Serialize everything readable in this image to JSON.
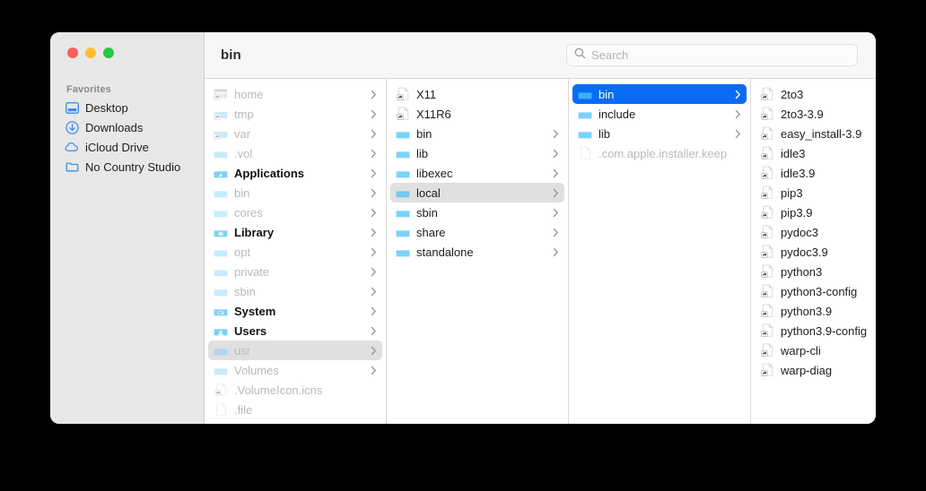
{
  "window": {
    "title": "bin",
    "traffic_lights": [
      {
        "name": "close-button",
        "color": "#ff5f57"
      },
      {
        "name": "minimize-button",
        "color": "#febc2e"
      },
      {
        "name": "maximize-button",
        "color": "#28c840"
      }
    ]
  },
  "search": {
    "placeholder": "Search",
    "value": "",
    "icon": "search-icon"
  },
  "sidebar": {
    "section_title": "Favorites",
    "items": [
      {
        "label": "Desktop",
        "icon": "desktop-icon"
      },
      {
        "label": "Downloads",
        "icon": "downloads-icon"
      },
      {
        "label": "iCloud Drive",
        "icon": "icloud-icon"
      },
      {
        "label": "No Country Studio",
        "icon": "folder-outline-icon"
      }
    ]
  },
  "columns": [
    {
      "name": "column-root",
      "items": [
        {
          "label": "home",
          "icon": "folder-alias-home-icon",
          "kind": "folder",
          "dim": true,
          "bold": false,
          "chevron": true,
          "selected": "none"
        },
        {
          "label": "tmp",
          "icon": "folder-alias-icon",
          "kind": "folder",
          "dim": true,
          "bold": false,
          "chevron": true,
          "selected": "none"
        },
        {
          "label": "var",
          "icon": "folder-alias-icon",
          "kind": "folder",
          "dim": true,
          "bold": false,
          "chevron": true,
          "selected": "none"
        },
        {
          "label": ".vol",
          "icon": "folder-icon",
          "kind": "folder",
          "dim": true,
          "bold": false,
          "chevron": true,
          "selected": "none"
        },
        {
          "label": "Applications",
          "icon": "applications-folder-icon",
          "kind": "folder",
          "dim": false,
          "bold": true,
          "chevron": true,
          "selected": "none"
        },
        {
          "label": "bin",
          "icon": "folder-icon",
          "kind": "folder",
          "dim": true,
          "bold": false,
          "chevron": true,
          "selected": "none"
        },
        {
          "label": "cores",
          "icon": "folder-icon",
          "kind": "folder",
          "dim": true,
          "bold": false,
          "chevron": true,
          "selected": "none"
        },
        {
          "label": "Library",
          "icon": "library-folder-icon",
          "kind": "folder",
          "dim": false,
          "bold": true,
          "chevron": true,
          "selected": "none"
        },
        {
          "label": "opt",
          "icon": "folder-icon",
          "kind": "folder",
          "dim": true,
          "bold": false,
          "chevron": true,
          "selected": "none"
        },
        {
          "label": "private",
          "icon": "folder-icon",
          "kind": "folder",
          "dim": true,
          "bold": false,
          "chevron": true,
          "selected": "none"
        },
        {
          "label": "sbin",
          "icon": "folder-icon",
          "kind": "folder",
          "dim": true,
          "bold": false,
          "chevron": true,
          "selected": "none"
        },
        {
          "label": "System",
          "icon": "system-folder-icon",
          "kind": "folder",
          "dim": false,
          "bold": true,
          "chevron": true,
          "selected": "none"
        },
        {
          "label": "Users",
          "icon": "users-folder-icon",
          "kind": "folder",
          "dim": false,
          "bold": true,
          "chevron": true,
          "selected": "none"
        },
        {
          "label": "usr",
          "icon": "folder-icon",
          "kind": "folder",
          "dim": true,
          "bold": false,
          "chevron": true,
          "selected": "inactive"
        },
        {
          "label": "Volumes",
          "icon": "folder-icon",
          "kind": "folder",
          "dim": true,
          "bold": false,
          "chevron": true,
          "selected": "none"
        },
        {
          "label": ".VolumeIcon.icns",
          "icon": "file-alias-icon",
          "kind": "file",
          "dim": true,
          "bold": false,
          "chevron": false,
          "selected": "none"
        },
        {
          "label": ".file",
          "icon": "file-icon",
          "kind": "file",
          "dim": true,
          "bold": false,
          "chevron": false,
          "selected": "none"
        }
      ]
    },
    {
      "name": "column-usr",
      "items": [
        {
          "label": "X11",
          "icon": "file-alias-icon",
          "kind": "file",
          "dim": false,
          "bold": false,
          "chevron": false,
          "selected": "none"
        },
        {
          "label": "X11R6",
          "icon": "file-alias-icon",
          "kind": "file",
          "dim": false,
          "bold": false,
          "chevron": false,
          "selected": "none"
        },
        {
          "label": "bin",
          "icon": "folder-icon",
          "kind": "folder",
          "dim": false,
          "bold": false,
          "chevron": true,
          "selected": "none"
        },
        {
          "label": "lib",
          "icon": "folder-icon",
          "kind": "folder",
          "dim": false,
          "bold": false,
          "chevron": true,
          "selected": "none"
        },
        {
          "label": "libexec",
          "icon": "folder-icon",
          "kind": "folder",
          "dim": false,
          "bold": false,
          "chevron": true,
          "selected": "none"
        },
        {
          "label": "local",
          "icon": "folder-icon",
          "kind": "folder",
          "dim": false,
          "bold": false,
          "chevron": true,
          "selected": "inactive"
        },
        {
          "label": "sbin",
          "icon": "folder-icon",
          "kind": "folder",
          "dim": false,
          "bold": false,
          "chevron": true,
          "selected": "none"
        },
        {
          "label": "share",
          "icon": "folder-icon",
          "kind": "folder",
          "dim": false,
          "bold": false,
          "chevron": true,
          "selected": "none"
        },
        {
          "label": "standalone",
          "icon": "folder-icon",
          "kind": "folder",
          "dim": false,
          "bold": false,
          "chevron": true,
          "selected": "none"
        }
      ]
    },
    {
      "name": "column-local",
      "items": [
        {
          "label": "bin",
          "icon": "folder-icon",
          "kind": "folder",
          "dim": false,
          "bold": false,
          "chevron": true,
          "selected": "active"
        },
        {
          "label": "include",
          "icon": "folder-icon",
          "kind": "folder",
          "dim": false,
          "bold": false,
          "chevron": true,
          "selected": "none"
        },
        {
          "label": "lib",
          "icon": "folder-icon",
          "kind": "folder",
          "dim": false,
          "bold": false,
          "chevron": true,
          "selected": "none"
        },
        {
          "label": ".com.apple.installer.keep",
          "icon": "file-icon",
          "kind": "file",
          "dim": true,
          "bold": false,
          "chevron": false,
          "selected": "none"
        }
      ]
    },
    {
      "name": "column-bin",
      "items": [
        {
          "label": "2to3",
          "icon": "file-alias-icon",
          "kind": "file",
          "dim": false,
          "bold": false,
          "chevron": false,
          "selected": "none"
        },
        {
          "label": "2to3-3.9",
          "icon": "file-alias-icon",
          "kind": "file",
          "dim": false,
          "bold": false,
          "chevron": false,
          "selected": "none"
        },
        {
          "label": "easy_install-3.9",
          "icon": "file-alias-icon",
          "kind": "file",
          "dim": false,
          "bold": false,
          "chevron": false,
          "selected": "none"
        },
        {
          "label": "idle3",
          "icon": "file-alias-icon",
          "kind": "file",
          "dim": false,
          "bold": false,
          "chevron": false,
          "selected": "none"
        },
        {
          "label": "idle3.9",
          "icon": "file-alias-icon",
          "kind": "file",
          "dim": false,
          "bold": false,
          "chevron": false,
          "selected": "none"
        },
        {
          "label": "pip3",
          "icon": "file-alias-icon",
          "kind": "file",
          "dim": false,
          "bold": false,
          "chevron": false,
          "selected": "none"
        },
        {
          "label": "pip3.9",
          "icon": "file-alias-icon",
          "kind": "file",
          "dim": false,
          "bold": false,
          "chevron": false,
          "selected": "none"
        },
        {
          "label": "pydoc3",
          "icon": "file-alias-icon",
          "kind": "file",
          "dim": false,
          "bold": false,
          "chevron": false,
          "selected": "none"
        },
        {
          "label": "pydoc3.9",
          "icon": "file-alias-icon",
          "kind": "file",
          "dim": false,
          "bold": false,
          "chevron": false,
          "selected": "none"
        },
        {
          "label": "python3",
          "icon": "file-alias-icon",
          "kind": "file",
          "dim": false,
          "bold": false,
          "chevron": false,
          "selected": "none"
        },
        {
          "label": "python3-config",
          "icon": "file-alias-icon",
          "kind": "file",
          "dim": false,
          "bold": false,
          "chevron": false,
          "selected": "none"
        },
        {
          "label": "python3.9",
          "icon": "file-alias-icon",
          "kind": "file",
          "dim": false,
          "bold": false,
          "chevron": false,
          "selected": "none"
        },
        {
          "label": "python3.9-config",
          "icon": "file-alias-icon",
          "kind": "file",
          "dim": false,
          "bold": false,
          "chevron": false,
          "selected": "none"
        },
        {
          "label": "warp-cli",
          "icon": "file-alias-icon",
          "kind": "file",
          "dim": false,
          "bold": false,
          "chevron": false,
          "selected": "none"
        },
        {
          "label": "warp-diag",
          "icon": "file-alias-icon",
          "kind": "file",
          "dim": false,
          "bold": false,
          "chevron": false,
          "selected": "none"
        }
      ]
    }
  ],
  "colors": {
    "accent_selection": "#0a6cf5",
    "inactive_selection": "#e0e0e0",
    "sidebar_bg": "#e9e8e8",
    "toolbar_bg": "#f7f7f7",
    "folder_blue": "#45bdf4",
    "sidebar_icon_blue": "#3b8ff0",
    "dim_text": "#b9b9bb"
  }
}
